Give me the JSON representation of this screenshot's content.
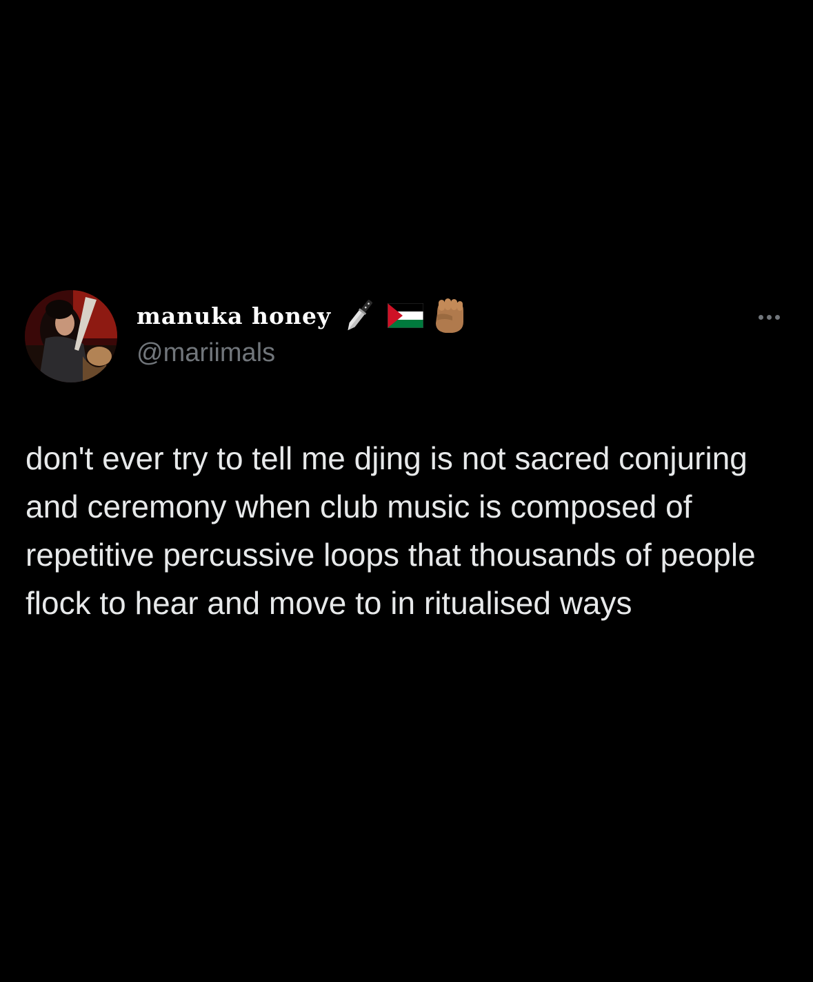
{
  "tweet": {
    "display_name": "manuka honey",
    "name_emojis": [
      "knife-icon",
      "palestine-flag-icon",
      "raised-fist-icon"
    ],
    "handle": "@mariimals",
    "text": "don't ever try to tell me djing is not sacred conjuring and ceremony when club music is composed of repetitive percussive loops that thousands of people flock to hear and move to in ritualised ways"
  },
  "colors": {
    "background": "#000000",
    "text": "#e7e9ea",
    "secondary_text": "#71767b",
    "flag_red": "#ce1126",
    "flag_green": "#007a3d",
    "fist_skin": "#b07a4d"
  }
}
